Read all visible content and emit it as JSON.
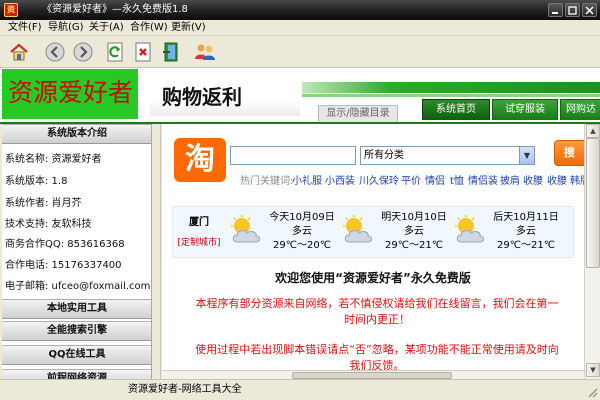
{
  "window": {
    "title": "《资源爱好者》—永久免费版1.8",
    "app_icon_glyph": "资"
  },
  "menu": [
    {
      "label": "文件(F)"
    },
    {
      "label": "导航(G)"
    },
    {
      "label": "关于(A)"
    },
    {
      "label": "合作(W)"
    },
    {
      "label": "更新(V)"
    }
  ],
  "toolbar": {
    "icons": [
      "home-icon",
      "back-icon",
      "forward-icon",
      "refresh-icon",
      "stop-icon",
      "exit-icon",
      "users-icon"
    ]
  },
  "header": {
    "logo_text": "资源爱好者",
    "banner_text": "购物返利",
    "toggle_dir_label": "显示/隐藏目录",
    "tabs": [
      {
        "label": "系统首页"
      },
      {
        "label": "试穿服装"
      },
      {
        "label": "网购达"
      }
    ]
  },
  "sidebar": {
    "system_head": "系统版本介绍",
    "info": [
      {
        "text": "系统名称: 资源爱好者"
      },
      {
        "text": "系统版本: 1.8"
      },
      {
        "text": "系统作者: 肖月芥"
      },
      {
        "text": "技术支持: 友软科技"
      },
      {
        "text": "商务合作QQ: 853616368"
      },
      {
        "text": "合作电话: 15176337400"
      },
      {
        "text": "电子邮箱:     ufceo@foxmail.com"
      }
    ],
    "sections": [
      {
        "label": "本地实用工具"
      },
      {
        "label": "全能搜索引擎"
      },
      {
        "label": "QQ在线工具"
      },
      {
        "label": "前程网络资源"
      }
    ]
  },
  "search": {
    "logo_glyph": "淘",
    "input_value": "",
    "category": "所有分类",
    "button_label": "搜",
    "hot_label": "热门关键词:",
    "hot_words": [
      "小礼服",
      "小西装",
      "川久保玲",
      "平价",
      "情侣",
      "t恤",
      "情侣装",
      "披肩",
      "收腰",
      "收腰",
      "韩版"
    ]
  },
  "weather": {
    "city": "厦门",
    "custom_city_link": "[定制城市]",
    "days": [
      {
        "date": "今天10月09日",
        "condition": "多云",
        "temp": "29℃～20℃"
      },
      {
        "date": "明天10月10日",
        "condition": "多云",
        "temp": "29℃～21℃"
      },
      {
        "date": "后天10月11日",
        "condition": "多云",
        "temp": "29℃～21℃"
      }
    ]
  },
  "content": {
    "welcome": "欢迎您使用“资源爱好者”永久免费版",
    "notice1": "本程序有部分资源来自网络，若不慎侵权请给我们在线留言，我们会在第一时间内更正！",
    "notice2": "使用过程中若出现脚本错误请点“否”忽略，某项功能不能正常使用请及时向我们反馈。"
  },
  "status": {
    "text": "资源爱好者-网络工具大全"
  }
}
